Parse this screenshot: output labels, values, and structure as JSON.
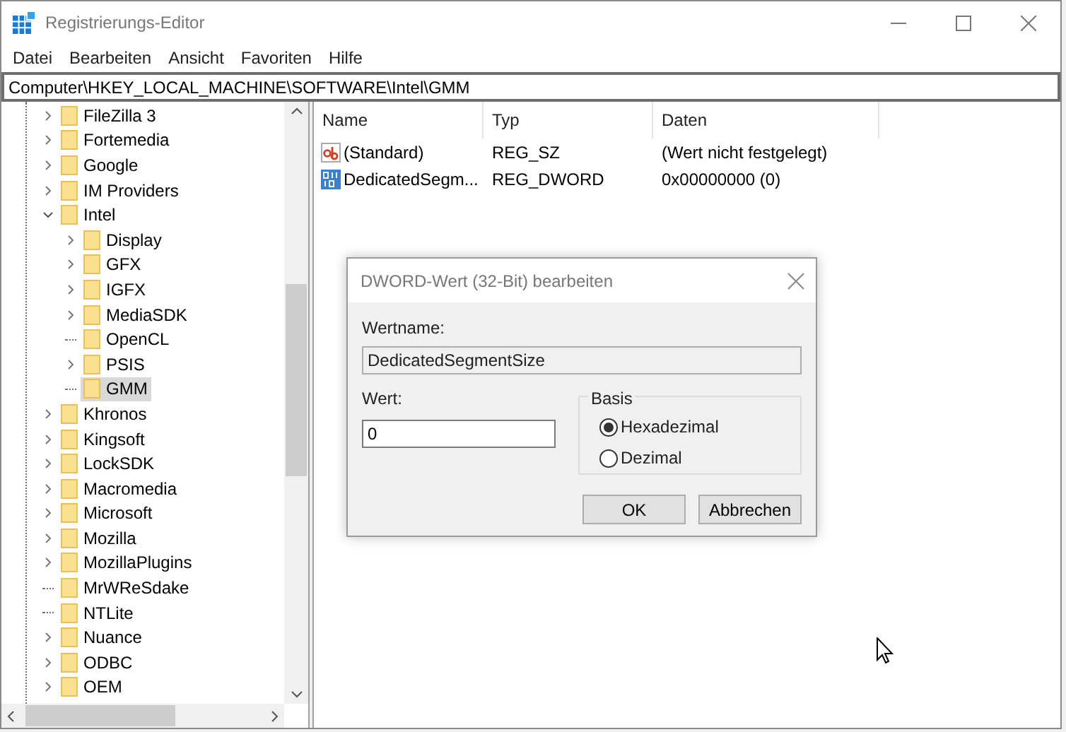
{
  "window": {
    "title": "Registrierungs-Editor"
  },
  "menu": [
    "Datei",
    "Bearbeiten",
    "Ansicht",
    "Favoriten",
    "Hilfe"
  ],
  "address": "Computer\\HKEY_LOCAL_MACHINE\\SOFTWARE\\Intel\\GMM",
  "tree": [
    {
      "label": "FileZilla 3",
      "expandable": true,
      "expanded": false,
      "selected": false
    },
    {
      "label": "Fortemedia",
      "expandable": true,
      "expanded": false,
      "selected": false
    },
    {
      "label": "Google",
      "expandable": true,
      "expanded": false,
      "selected": false
    },
    {
      "label": "IM Providers",
      "expandable": true,
      "expanded": false,
      "selected": false
    },
    {
      "label": "Intel",
      "expandable": true,
      "expanded": true,
      "selected": false,
      "children": [
        {
          "label": "Display",
          "expandable": true,
          "expanded": false,
          "selected": false
        },
        {
          "label": "GFX",
          "expandable": true,
          "expanded": false,
          "selected": false
        },
        {
          "label": "IGFX",
          "expandable": true,
          "expanded": false,
          "selected": false
        },
        {
          "label": "MediaSDK",
          "expandable": true,
          "expanded": false,
          "selected": false
        },
        {
          "label": "OpenCL",
          "expandable": false,
          "expanded": false,
          "selected": false
        },
        {
          "label": "PSIS",
          "expandable": true,
          "expanded": false,
          "selected": false
        },
        {
          "label": "GMM",
          "expandable": false,
          "expanded": false,
          "selected": true
        }
      ]
    },
    {
      "label": "Khronos",
      "expandable": true,
      "expanded": false,
      "selected": false
    },
    {
      "label": "Kingsoft",
      "expandable": true,
      "expanded": false,
      "selected": false
    },
    {
      "label": "LockSDK",
      "expandable": true,
      "expanded": false,
      "selected": false
    },
    {
      "label": "Macromedia",
      "expandable": true,
      "expanded": false,
      "selected": false
    },
    {
      "label": "Microsoft",
      "expandable": true,
      "expanded": false,
      "selected": false
    },
    {
      "label": "Mozilla",
      "expandable": true,
      "expanded": false,
      "selected": false
    },
    {
      "label": "MozillaPlugins",
      "expandable": true,
      "expanded": false,
      "selected": false
    },
    {
      "label": "MrWReSdake",
      "expandable": false,
      "expanded": false,
      "selected": false
    },
    {
      "label": "NTLite",
      "expandable": false,
      "expanded": false,
      "selected": false
    },
    {
      "label": "Nuance",
      "expandable": true,
      "expanded": false,
      "selected": false
    },
    {
      "label": "ODBC",
      "expandable": true,
      "expanded": false,
      "selected": false
    },
    {
      "label": "OEM",
      "expandable": true,
      "expanded": false,
      "selected": false
    }
  ],
  "table": {
    "columns": [
      "Name",
      "Typ",
      "Daten"
    ],
    "rows": [
      {
        "kind": "string",
        "name": "(Standard)",
        "type": "REG_SZ",
        "data": "(Wert nicht festgelegt)"
      },
      {
        "kind": "binary",
        "name": "DedicatedSegm...",
        "type": "REG_DWORD",
        "data": "0x00000000 (0)"
      }
    ]
  },
  "dialog": {
    "title": "DWORD-Wert (32-Bit) bearbeiten",
    "name_label": "Wertname:",
    "name_value": "DedicatedSegmentSize",
    "value_label": "Wert:",
    "value": "0",
    "base_label": "Basis",
    "bases": [
      {
        "label": "Hexadezimal",
        "selected": true
      },
      {
        "label": "Dezimal",
        "selected": false
      }
    ],
    "buttons": [
      "OK",
      "Abbrechen"
    ]
  }
}
